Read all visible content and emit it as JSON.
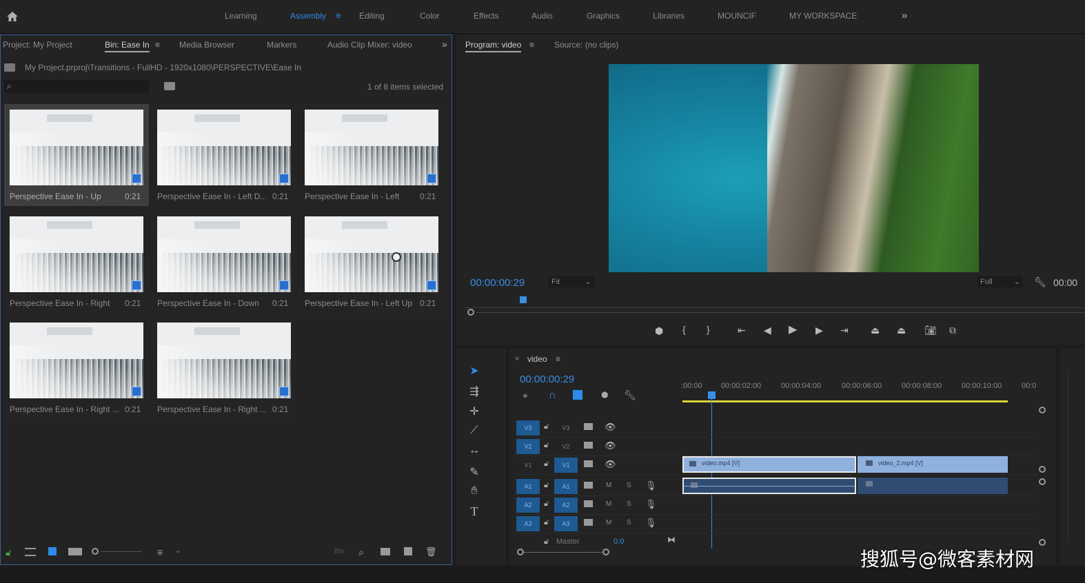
{
  "workspace_tabs": [
    "Learning",
    "Assembly",
    "Editing",
    "Color",
    "Effects",
    "Audio",
    "Graphics",
    "Libraries",
    "MOUNCIF",
    "MY WORKSPACE"
  ],
  "active_workspace": "Assembly",
  "project_panel": {
    "tabs": [
      "Project: My Project",
      "Bin: Ease In",
      "Media Browser",
      "Markers",
      "Audio Clip Mixer: video"
    ],
    "path": "My Project.prproj\\Transitions - FullHD - 1920x1080\\PERSPECTIVE\\Ease In",
    "selection_status": "1 of 8 items selected",
    "items": [
      {
        "label": "Perspective Ease In - Up",
        "duration": "0:21",
        "selected": true
      },
      {
        "label": "Perspective Ease In - Left D...",
        "duration": "0:21"
      },
      {
        "label": "Perspective Ease In - Left",
        "duration": "0:21"
      },
      {
        "label": "Perspective Ease In - Right",
        "duration": "0:21"
      },
      {
        "label": "Perspective Ease In - Down",
        "duration": "0:21"
      },
      {
        "label": "Perspective Ease In - Left Up",
        "duration": "0:21"
      },
      {
        "label": "Perspective Ease In - Right ...",
        "duration": "0:21"
      },
      {
        "label": "Perspective Ease In - Right ...",
        "duration": "0:21"
      }
    ],
    "footer_bin_label": "Bin"
  },
  "program_monitor": {
    "tab_program": "Program: video",
    "tab_source": "Source: (no clips)",
    "timecode": "00:00:00:29",
    "fit": "Fit",
    "quality": "Full",
    "end_timecode": "00:00"
  },
  "timeline": {
    "sequence_name": "video",
    "timecode": "00:00:00:29",
    "ruler": [
      ":00:00",
      "00:00:02:00",
      "00:00:04:00",
      "00:00:06:00",
      "00:00:08:00",
      "00:00:10:00",
      "00:0"
    ],
    "video_tracks": [
      {
        "src": "V3",
        "name": "V3"
      },
      {
        "src": "V2",
        "name": "V2"
      },
      {
        "src": "V1",
        "name": "V1"
      }
    ],
    "audio_tracks": [
      {
        "src": "A1",
        "name": "A1",
        "m": "M",
        "s": "S"
      },
      {
        "src": "A2",
        "name": "A2",
        "m": "M",
        "s": "S"
      },
      {
        "src": "A3",
        "name": "A3",
        "m": "M",
        "s": "S"
      }
    ],
    "master_label": "Master",
    "master_value": "0.0",
    "clips": [
      "video.mp4 [V]",
      "video_2.mp4 [V]"
    ]
  },
  "watermark": "搜狐号@微客素材网",
  "colors": {
    "accent": "#2d8ceb",
    "clip_video": "#8fb1de",
    "clip_audio": "#2f4c72",
    "track_button": "#1f5a93",
    "playhead": "#3a8ee6"
  }
}
